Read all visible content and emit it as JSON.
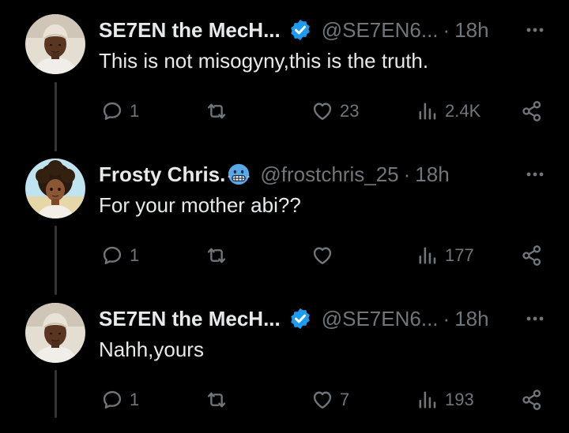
{
  "colors": {
    "background": "#000000",
    "text": "#e7e9ea",
    "muted": "#71767b",
    "verified": "#1d9bf0",
    "thread_line": "#333639"
  },
  "tweets": [
    {
      "author_name": "SE7EN the MecH...",
      "handle": "@SE7EN6...",
      "separator": "·",
      "time": "18h",
      "text": "This is not misogyny,this is the truth.",
      "badge": "verified-badge-icon",
      "replies": "1",
      "retweets": "",
      "likes": "23",
      "views": "2.4K"
    },
    {
      "author_name": "Frosty Chris.",
      "handle": "@frostchris_25",
      "separator": "·",
      "time": "18h",
      "text": "For your mother abi??",
      "badge": "cold-face-emoji-icon",
      "replies": "1",
      "retweets": "",
      "likes": "",
      "views": "177"
    },
    {
      "author_name": "SE7EN the MecH...",
      "handle": "@SE7EN6...",
      "separator": "·",
      "time": "18h",
      "text": "Nahh,yours",
      "badge": "verified-badge-icon",
      "replies": "1",
      "retweets": "",
      "likes": "7",
      "views": "193"
    }
  ]
}
